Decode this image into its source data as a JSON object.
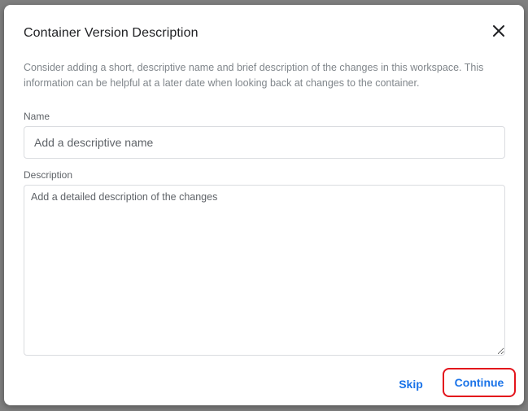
{
  "dialog": {
    "title": "Container Version Description",
    "close_icon": "close-icon",
    "intro": "Consider adding a short, descriptive name and brief description of the changes in this workspace. This information can be helpful at a later date when looking back at changes to the container.",
    "name_field": {
      "label": "Name",
      "value": "",
      "placeholder": "Add a descriptive name"
    },
    "description_field": {
      "label": "Description",
      "value": "",
      "placeholder": "Add a detailed description of the changes"
    },
    "actions": {
      "skip_label": "Skip",
      "continue_label": "Continue"
    }
  },
  "colors": {
    "accent": "#1a73e8",
    "highlight_border": "#e3141c",
    "backdrop": "#7f7f7f",
    "muted_text": "#80868b"
  }
}
